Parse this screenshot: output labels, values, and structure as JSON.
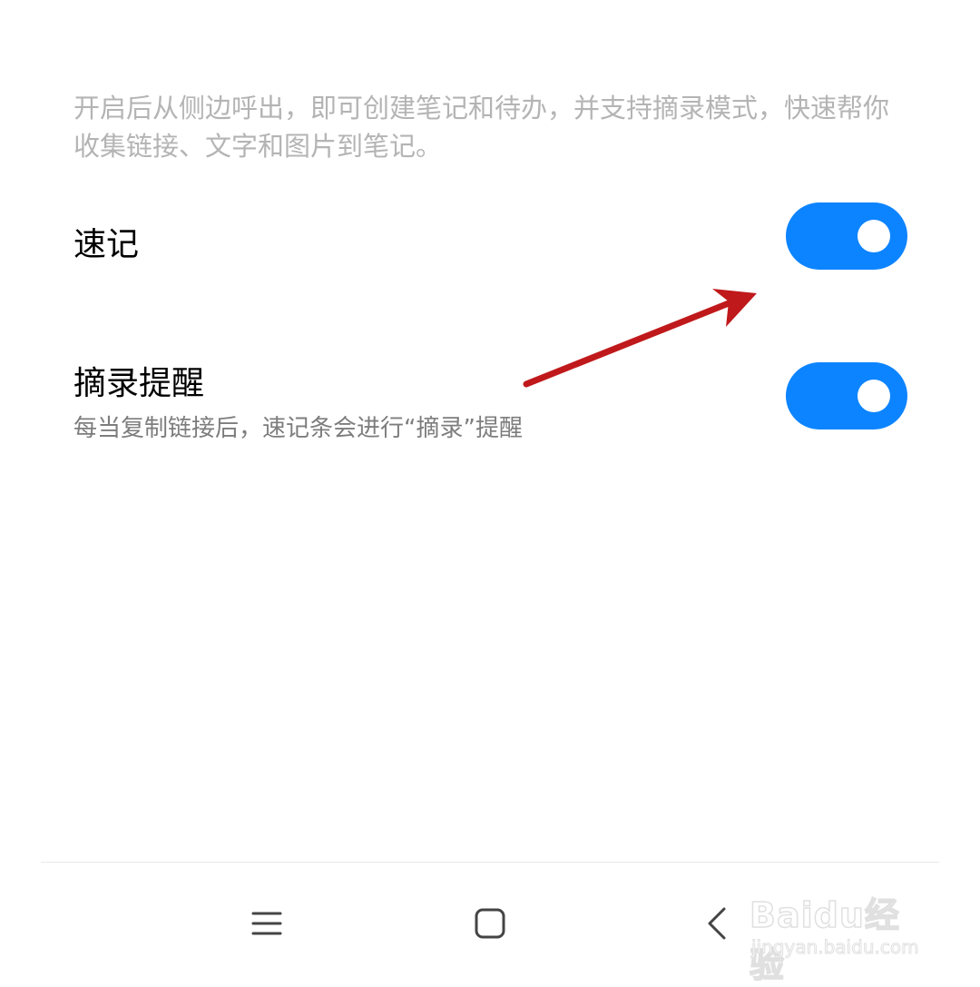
{
  "description": "开启后从侧边呼出，即可创建笔记和待办，并支持摘录模式，快速帮你收集链接、文字和图片到笔记。",
  "settings": [
    {
      "title": "速记",
      "subtitle": "",
      "enabled": true
    },
    {
      "title": "摘录提醒",
      "subtitle": "每当复制链接后，速记条会进行“摘录”提醒",
      "enabled": true
    }
  ],
  "navbar": {
    "menu_icon": "menu-icon",
    "home_icon": "home-icon",
    "back_icon": "back-icon"
  },
  "watermark": {
    "brand": "Baidu经验",
    "url": "jingyan.baidu.com"
  },
  "colors": {
    "toggle_on": "#0d84ff",
    "annotation_arrow": "#c0191b"
  }
}
